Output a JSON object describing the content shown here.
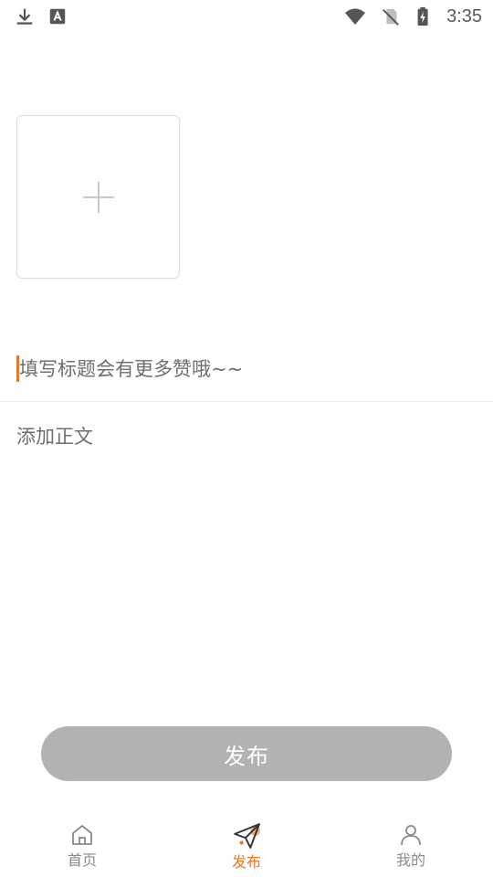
{
  "status_bar": {
    "time": "3:35",
    "icons": [
      "download-icon",
      "keyboard-a-icon",
      "wifi-icon",
      "no-sim-icon",
      "battery-charging-icon"
    ]
  },
  "editor": {
    "image_add_icon": "plus-icon",
    "title_placeholder": "填写标题会有更多赞哦~~",
    "body_placeholder": "添加正文",
    "title_value": "",
    "body_value": ""
  },
  "publish_button": {
    "label": "发布",
    "color": "#b2b2b2"
  },
  "bottom_nav": {
    "accent_color": "#e8782a",
    "items": [
      {
        "label": "首页",
        "icon": "home-icon",
        "active": false
      },
      {
        "label": "发布",
        "icon": "send-icon",
        "active": true
      },
      {
        "label": "我的",
        "icon": "user-icon",
        "active": false
      }
    ]
  }
}
